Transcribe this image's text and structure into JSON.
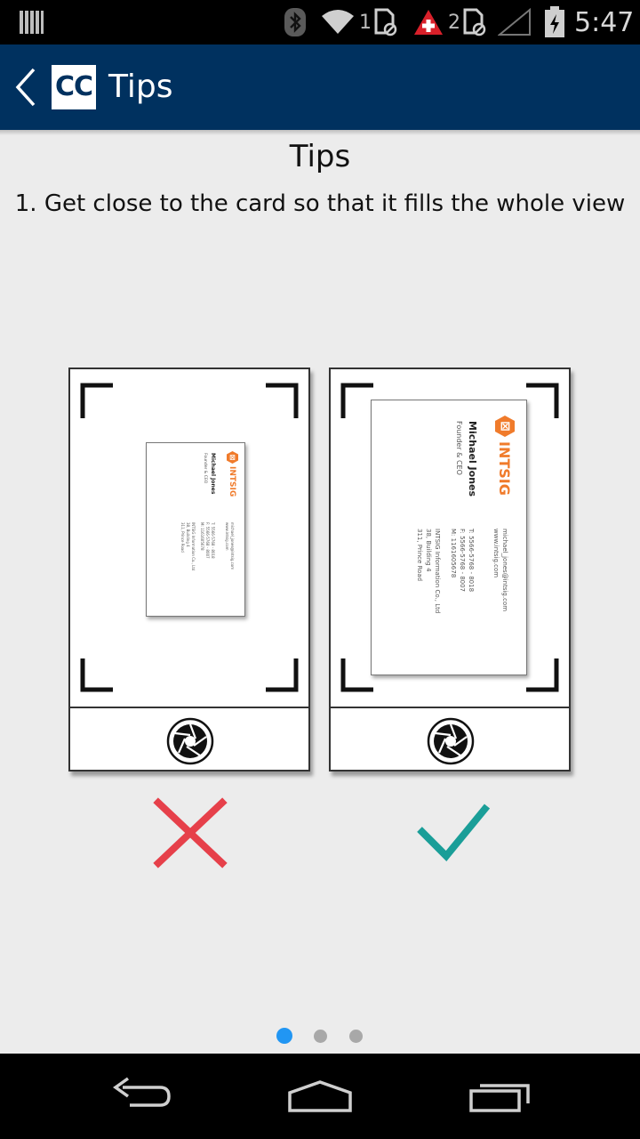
{
  "status_bar": {
    "time": "5:47",
    "sim1_label": "1",
    "sim2_label": "2",
    "icons": [
      "notification-bars-icon",
      "bluetooth-icon",
      "wifi-icon",
      "sim1-data-blocked-icon",
      "warning-plus-icon",
      "sim2-data-blocked-icon",
      "cell-signal-icon",
      "battery-charging-icon"
    ]
  },
  "app_bar": {
    "logo_text": "CC",
    "title": "Tips",
    "color": "#00315f"
  },
  "content": {
    "heading": "Tips",
    "tip": "1. Get close to the card so that it fills the whole view"
  },
  "illustration": {
    "card": {
      "logo_text": "INTSIG",
      "name": "Michael Jones",
      "role": "Founder & CEO",
      "contact_lines": [
        "michael_jones@intsig.com",
        "www.intsig.com"
      ],
      "phone_lines": [
        "T: 5566-5768 - 8018",
        "F: 5566-5768 - 8007",
        "M: 1161605678"
      ],
      "address_lines": [
        "INTSIG Information Co., Ltd",
        "38, Building 4",
        "311, Prince Road"
      ]
    },
    "wrong_color": "#e6404a",
    "right_color": "#1a9e98"
  },
  "pager": {
    "pages": 3,
    "current": 1,
    "active_color": "#2196f3",
    "inactive_color": "#a8a8a8"
  }
}
